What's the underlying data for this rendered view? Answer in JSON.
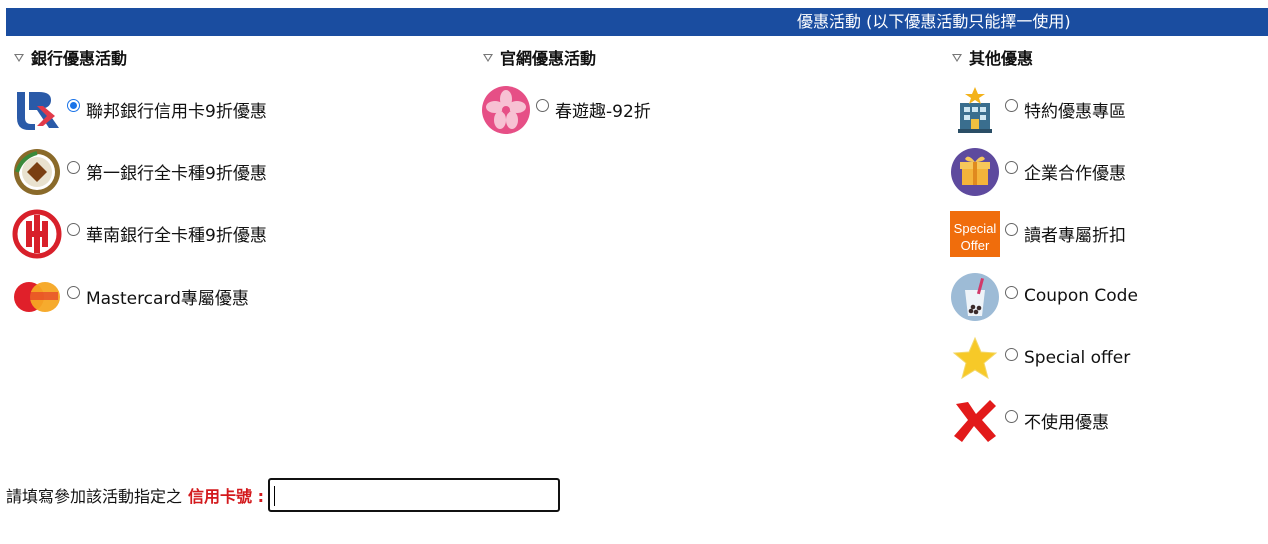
{
  "header": {
    "title": "優惠活動 (以下優惠活動只能擇一使用)"
  },
  "columns": {
    "bank": {
      "heading": "銀行優惠活動",
      "options": [
        {
          "label": "聯邦銀行信用卡9折優惠",
          "icon": "union-bank-logo-icon",
          "selected": true
        },
        {
          "label": "第一銀行全卡種9折優惠",
          "icon": "first-bank-logo-icon",
          "selected": false
        },
        {
          "label": "華南銀行全卡種9折優惠",
          "icon": "hua-nan-bank-logo-icon",
          "selected": false
        },
        {
          "label": "Mastercard專屬優惠",
          "icon": "mastercard-logo-icon",
          "selected": false
        }
      ]
    },
    "official": {
      "heading": "官網優惠活動",
      "options": [
        {
          "label": "春遊趣-92折",
          "icon": "cherry-blossom-icon",
          "selected": false
        }
      ]
    },
    "other": {
      "heading": "其他優惠",
      "options": [
        {
          "label": "特約優惠專區",
          "icon": "building-icon",
          "selected": false
        },
        {
          "label": "企業合作優惠",
          "icon": "gift-box-icon",
          "selected": false
        },
        {
          "label": "讀者專屬折扣",
          "icon": "special-offer-tag-icon",
          "selected": false,
          "icon_text": [
            "Special",
            "Offer"
          ]
        },
        {
          "label": "Coupon Code",
          "icon": "bubble-tea-icon",
          "selected": false
        },
        {
          "label": "Special offer",
          "icon": "star-icon",
          "selected": false
        },
        {
          "label": "不使用優惠",
          "icon": "red-x-icon",
          "selected": false
        }
      ]
    }
  },
  "footer": {
    "prompt": "請填寫參加該活動指定之",
    "required_label": "信用卡號 :",
    "card_number_value": ""
  },
  "colors": {
    "banner": "#1a4da0",
    "required": "#d3191c",
    "radio_checked": "#1a73e8"
  }
}
